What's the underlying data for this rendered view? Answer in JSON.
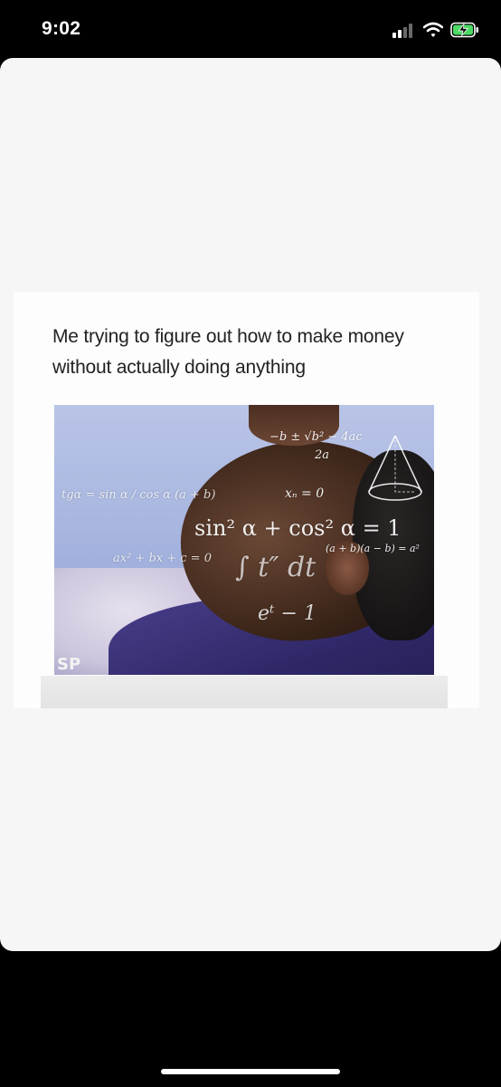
{
  "status_bar": {
    "time": "9:02",
    "icons": [
      "signal-icon",
      "wifi-icon",
      "battery-charging-icon"
    ]
  },
  "meme": {
    "caption": "Me trying to figure out how to make money without actually doing anything",
    "watermark": "SP",
    "formulas": {
      "quadratic_numerator": "−b ± √b² − 4ac",
      "quadratic_denominator": "2a",
      "tangent": "tgα = sin α / cos α (a + b)",
      "trig_identity": "sin² α + cos² α = 1",
      "root": "xₙ = 0",
      "difference_of_squares": "(a + b)(a − b) = a²",
      "polynomial": "ax² + bx + c = 0",
      "integral": "∫ t″ dt",
      "integral_denominator": "eᵗ − 1"
    }
  },
  "colors": {
    "background": "#000000",
    "sheet": "#f6f6f6",
    "card": "#fdfdfd",
    "caption_text": "#222222"
  }
}
